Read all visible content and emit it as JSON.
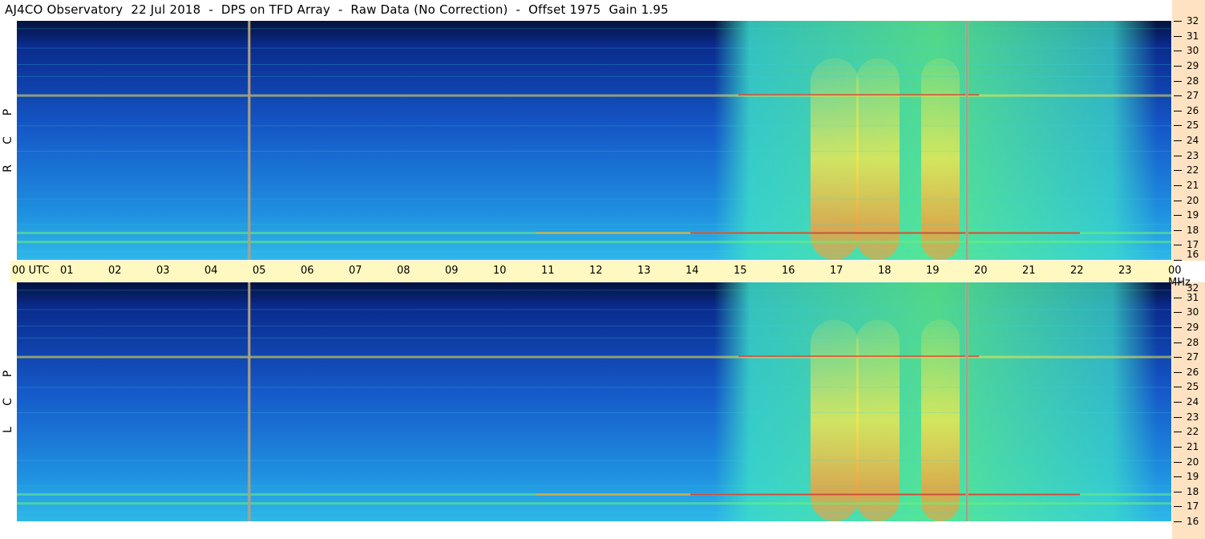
{
  "title": "AJ4CO Observatory  22 Jul 2018  -  DPS on TFD Array  -  Raw Data (No Correction)  -  Offset 1975  Gain 1.95",
  "panels": [
    {
      "id": "rcp",
      "side_letters": [
        "P",
        "C",
        "R"
      ]
    },
    {
      "id": "lcp",
      "side_letters": [
        "P",
        "C",
        "L"
      ]
    }
  ],
  "time_axis": {
    "ticks": [
      "00 UTC",
      "01",
      "02",
      "03",
      "04",
      "05",
      "06",
      "07",
      "08",
      "09",
      "10",
      "11",
      "12",
      "13",
      "14",
      "15",
      "16",
      "17",
      "18",
      "19",
      "20",
      "21",
      "22",
      "23",
      "00 MHz"
    ]
  },
  "freq_axis": {
    "ticks": [
      "32",
      "31",
      "30",
      "29",
      "28",
      "27",
      "26",
      "25",
      "24",
      "23",
      "22",
      "21",
      "20",
      "19",
      "18",
      "17",
      "16"
    ]
  },
  "colors": {
    "background_low": "#0a2a8c",
    "background_mid": "#1f8fe0",
    "cyan": "#35d6e8",
    "green": "#6cf07a",
    "yellow": "#f2e850",
    "orange": "#f0a040",
    "red": "#e03030",
    "time_axis_bg": "#fff8c0",
    "freq_axis_bg": "#ffe2c2"
  },
  "chart_data": {
    "type": "heatmap",
    "title": "AJ4CO Observatory  22 Jul 2018  -  DPS on TFD Array  -  Raw Data (No Correction)  -  Offset 1975  Gain 1.95",
    "xlabel": "UTC",
    "ylabel": "MHz",
    "xlim": [
      0,
      24
    ],
    "ylim": [
      16,
      32
    ],
    "x_ticks": [
      0,
      1,
      2,
      3,
      4,
      5,
      6,
      7,
      8,
      9,
      10,
      11,
      12,
      13,
      14,
      15,
      16,
      17,
      18,
      19,
      20,
      21,
      22,
      23,
      24
    ],
    "y_ticks": [
      16,
      17,
      18,
      19,
      20,
      21,
      22,
      23,
      24,
      25,
      26,
      27,
      28,
      29,
      30,
      31,
      32
    ],
    "series": [
      {
        "name": "RCP",
        "vertical_lines_utc": [
          4.83,
          19.75
        ],
        "strong_bands_mhz": [
          27.0,
          17.8,
          17.2
        ],
        "daytime_enhancement_utc": [
          14.5,
          22.5
        ]
      },
      {
        "name": "LCP",
        "vertical_lines_utc": [
          4.83,
          19.75
        ],
        "strong_bands_mhz": [
          27.0,
          17.8,
          17.2
        ],
        "daytime_enhancement_utc": [
          14.5,
          22.5
        ]
      }
    ]
  }
}
